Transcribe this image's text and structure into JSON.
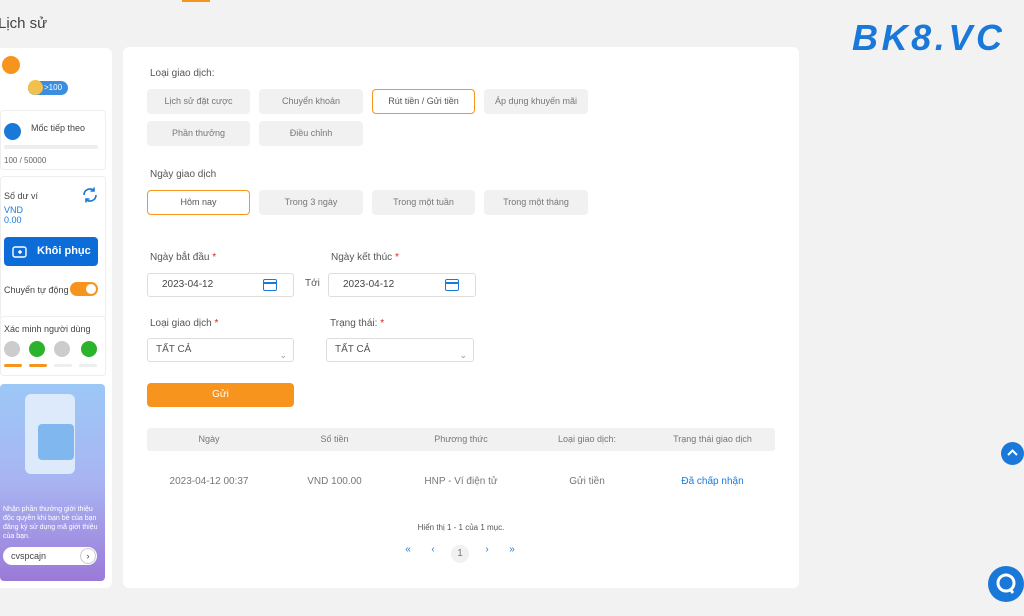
{
  "header": {
    "title": "Lịch sử"
  },
  "logo": {
    "text": "BK8.VC"
  },
  "sidebar": {
    "vip_badge": ">100",
    "milestone_label": "Mốc tiếp theo",
    "milestone_progress": "100 / 50000",
    "wallet_label": "Số dư ví",
    "wallet_currency": "VND",
    "wallet_amount": "0.00",
    "restore_button": "Khôi phục",
    "auto_transfer_label": "Chuyển tự động",
    "auto_transfer_on": true,
    "verify_label": "Xác minh người dùng",
    "promo_text": "Nhận phần thưởng giới thiệu độc quyền khi bạn bè của bạn đăng ký sử dụng mã giới thiệu của bạn.",
    "referral_code": "cvspcajn"
  },
  "filters": {
    "txn_type_label": "Loại giao dịch:",
    "txn_types": [
      "Lịch sử đặt cược",
      "Chuyển khoản",
      "Rút tiền / Gửi tiền",
      "Áp dụng khuyến mãi",
      "Phần thưởng",
      "Điều chỉnh"
    ],
    "txn_type_active": "Rút tiền / Gửi tiền",
    "date_label": "Ngày giao dịch",
    "date_ranges": [
      "Hôm nay",
      "Trong 3 ngày",
      "Trong một tuần",
      "Trong một tháng"
    ],
    "date_active": "Hôm nay",
    "start_label": "Ngày bắt đầu",
    "start_value": "2023-04-12",
    "to_label": "Tới",
    "end_label": "Ngày kết thúc",
    "end_value": "2023-04-12",
    "type_select_label": "Loại giao dịch",
    "type_select_value": "TẤT CẢ",
    "status_select_label": "Trạng thái:",
    "status_select_value": "TẤT CẢ",
    "required_mark": "*",
    "submit": "Gửi"
  },
  "table": {
    "headers": [
      "Ngày",
      "Số tiền",
      "Phương thức",
      "Loại giao dịch:",
      "Trạng thái giao dịch"
    ],
    "rows": [
      [
        "2023-04-12 00:37",
        "VND 100.00",
        "HNP - Ví điện tử",
        "Gửi tiền",
        "Đã chấp nhận"
      ]
    ]
  },
  "pagination": {
    "info": "Hiển thị 1 - 1 của 1 mục.",
    "first": "«",
    "prev": "‹",
    "current": "1",
    "next": "›",
    "last": "»"
  },
  "colors": {
    "accent": "#f7941d",
    "primary": "#1a79d8",
    "success": "#2bb32b"
  }
}
